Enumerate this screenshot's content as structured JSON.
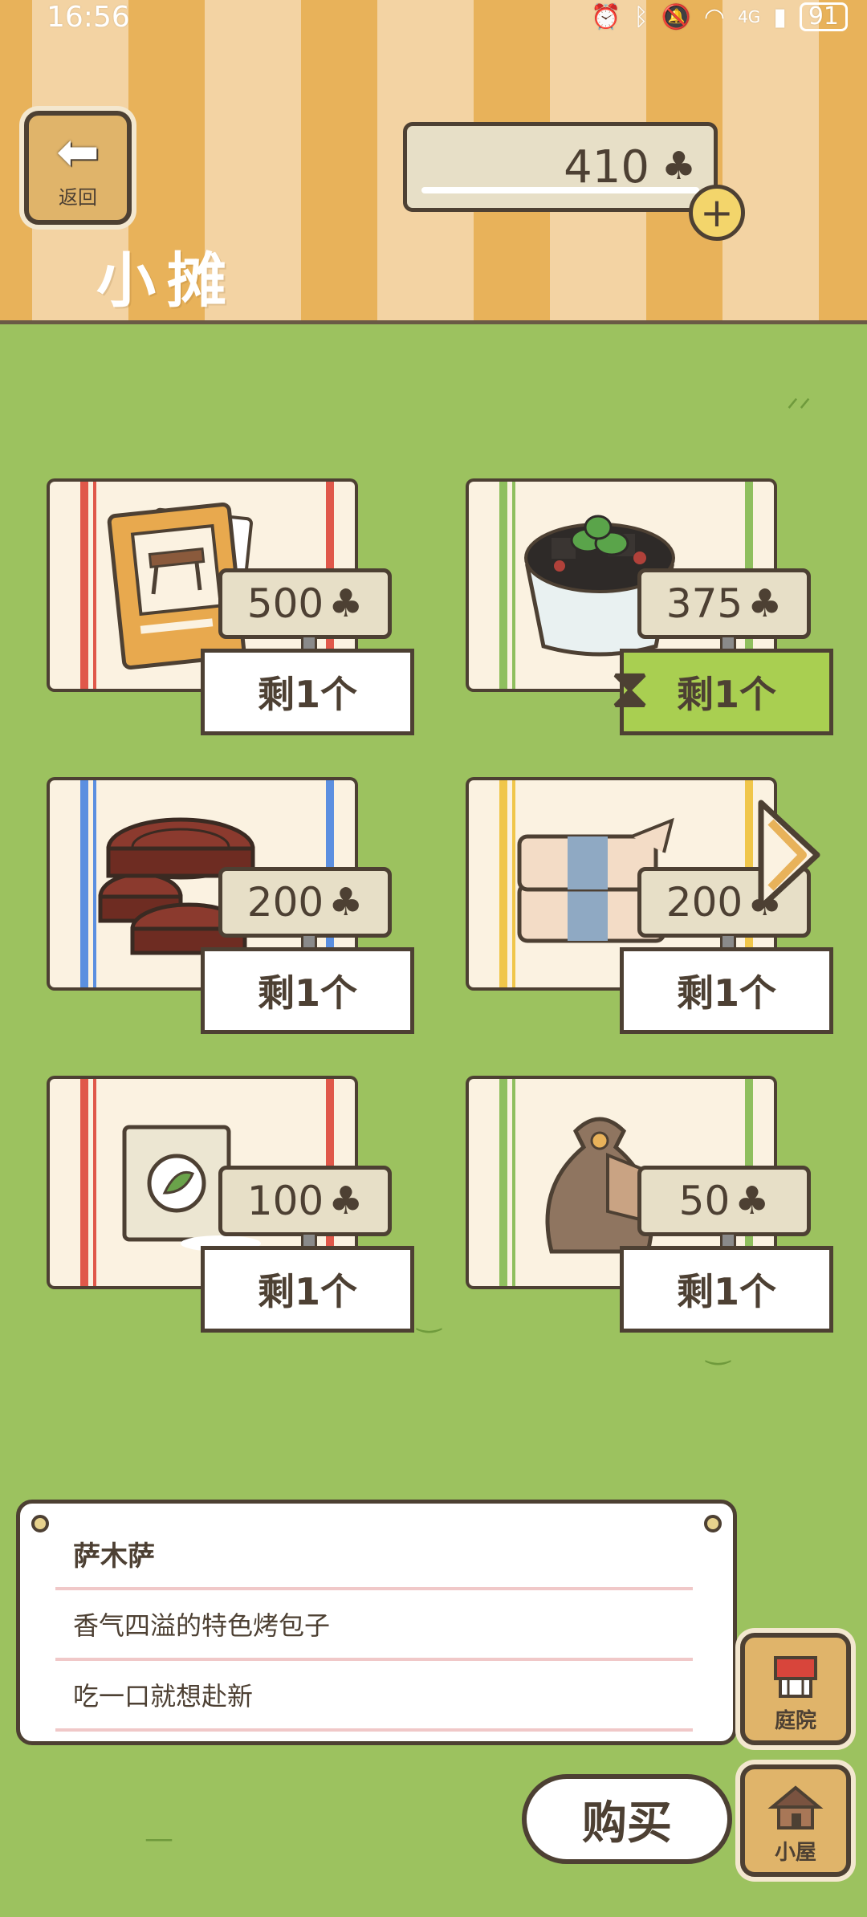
{
  "status_bar": {
    "time": "16:56",
    "network": "4G",
    "battery": "91"
  },
  "header": {
    "back_label": "返回",
    "title": "小摊",
    "currency_amount": "410",
    "currency_icon": "clover-icon"
  },
  "items": [
    {
      "price": "500",
      "stock": "剩1个",
      "art": "furniture-card",
      "stripe_color": "#e0584a",
      "stock_highlight": false
    },
    {
      "price": "375",
      "stock": "剩1个",
      "art": "grass-jelly-bowl",
      "stripe_color": "#8fbf5e",
      "stock_highlight": true
    },
    {
      "price": "200",
      "stock": "剩1个",
      "art": "wood-logs",
      "stripe_color": "#5b8fe0",
      "stock_highlight": false
    },
    {
      "price": "200",
      "stock": "剩1个",
      "art": "cloth-pillow",
      "stripe_color": "#f0c64a",
      "stock_highlight": false
    },
    {
      "price": "100",
      "stock": "剩1个",
      "art": "seed-bag",
      "stripe_color": "#e0584a",
      "stock_highlight": false
    },
    {
      "price": "50",
      "stock": "剩1个",
      "art": "sack",
      "stripe_color": "#8fbf5e",
      "stock_highlight": false
    }
  ],
  "description": {
    "name": "萨木萨",
    "line1": "香气四溢的特色烤包子",
    "line2": "吃一口就想赴新"
  },
  "buttons": {
    "yard": "庭院",
    "house": "小屋",
    "buy": "购买"
  },
  "colors": {
    "grass": "#9cc25f",
    "outline": "#4d4033",
    "tag": "#e7dfc7",
    "highlight": "#a9cf51"
  }
}
